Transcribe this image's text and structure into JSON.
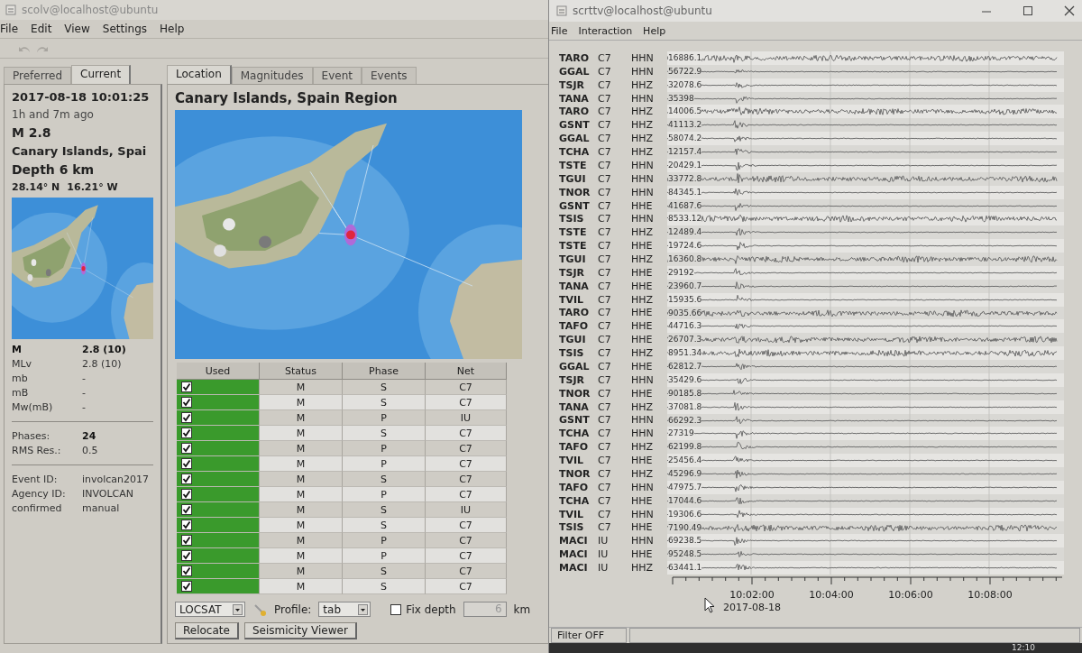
{
  "scolv": {
    "title": "scolv@localhost@ubuntu",
    "menu": [
      "File",
      "Edit",
      "View",
      "Settings",
      "Help"
    ],
    "summary_tabs": [
      {
        "label": "Preferred",
        "selected": false
      },
      {
        "label": "Current",
        "selected": true
      }
    ],
    "origin": {
      "time": "2017-08-18 10:01:25",
      "age": "1h and 7m ago",
      "magnitude": "M 2.8",
      "region": "Canary Islands, Spai",
      "depth": "Depth 6 km",
      "latitude": "28.14° N",
      "longitude": "16.21° W"
    },
    "magnitudes": [
      {
        "type": "M",
        "value": "2.8 (10)",
        "emphasized": true
      },
      {
        "type": "MLv",
        "value": "2.8 (10)",
        "emphasized": false
      },
      {
        "type": "mb",
        "value": "-",
        "emphasized": false
      },
      {
        "type": "mB",
        "value": "-",
        "emphasized": false
      },
      {
        "type": "Mw(mB)",
        "value": "-",
        "emphasized": false
      }
    ],
    "quality": [
      {
        "label": "Phases:",
        "value": "24",
        "emphasized": true
      },
      {
        "label": "RMS Res.:",
        "value": "0.5",
        "emphasized": false
      }
    ],
    "event_info": [
      {
        "label": "Event ID:",
        "value": "involcan2017"
      },
      {
        "label": "Agency ID:",
        "value": "INVOLCAN"
      },
      {
        "label": "confirmed",
        "value": "manual"
      }
    ],
    "tabs": [
      {
        "label": "Location",
        "selected": true
      },
      {
        "label": "Magnitudes",
        "selected": false
      },
      {
        "label": "Event",
        "selected": false
      },
      {
        "label": "Events",
        "selected": false
      }
    ],
    "region_title": "Canary Islands, Spain Region",
    "arrivals": {
      "columns": [
        "Used",
        "Status",
        "Phase",
        "Net"
      ],
      "rows": [
        {
          "used": true,
          "status": "M",
          "phase": "S",
          "net": "C7"
        },
        {
          "used": true,
          "status": "M",
          "phase": "S",
          "net": "C7"
        },
        {
          "used": true,
          "status": "M",
          "phase": "P",
          "net": "IU"
        },
        {
          "used": true,
          "status": "M",
          "phase": "S",
          "net": "C7"
        },
        {
          "used": true,
          "status": "M",
          "phase": "P",
          "net": "C7"
        },
        {
          "used": true,
          "status": "M",
          "phase": "P",
          "net": "C7"
        },
        {
          "used": true,
          "status": "M",
          "phase": "S",
          "net": "C7"
        },
        {
          "used": true,
          "status": "M",
          "phase": "P",
          "net": "C7"
        },
        {
          "used": true,
          "status": "M",
          "phase": "S",
          "net": "IU"
        },
        {
          "used": true,
          "status": "M",
          "phase": "S",
          "net": "C7"
        },
        {
          "used": true,
          "status": "M",
          "phase": "P",
          "net": "C7"
        },
        {
          "used": true,
          "status": "M",
          "phase": "P",
          "net": "C7"
        },
        {
          "used": true,
          "status": "M",
          "phase": "S",
          "net": "C7"
        },
        {
          "used": true,
          "status": "M",
          "phase": "S",
          "net": "C7"
        }
      ]
    },
    "locator": {
      "value": "LOCSAT"
    },
    "profile": {
      "label": "Profile:",
      "value": "tab"
    },
    "fix_depth": {
      "label": "Fix depth",
      "checked": false
    },
    "depth_field": {
      "value": "6",
      "disabled": true,
      "unit": "km"
    },
    "buttons": [
      "Relocate",
      "Seismicity Viewer"
    ]
  },
  "scrttv": {
    "title": "scrttv@localhost@ubuntu",
    "menu": [
      "File",
      "Interaction",
      "Help"
    ],
    "traces": [
      {
        "station": "TARO",
        "network": "C7",
        "channel": "HHN",
        "amplitude": "16886.1",
        "kind": "noisy"
      },
      {
        "station": "GGAL",
        "network": "C7",
        "channel": "HHN",
        "amplitude": "56722.9",
        "kind": "quiet"
      },
      {
        "station": "TSJR",
        "network": "C7",
        "channel": "HHZ",
        "amplitude": "32078.6",
        "kind": "quiet"
      },
      {
        "station": "TANA",
        "network": "C7",
        "channel": "HHN",
        "amplitude": "35398",
        "kind": "quiet"
      },
      {
        "station": "TARO",
        "network": "C7",
        "channel": "HHZ",
        "amplitude": "14006.5",
        "kind": "noisy"
      },
      {
        "station": "GSNT",
        "network": "C7",
        "channel": "HHZ",
        "amplitude": "41113.2",
        "kind": "quiet"
      },
      {
        "station": "GGAL",
        "network": "C7",
        "channel": "HHZ",
        "amplitude": "58074.2",
        "kind": "quiet"
      },
      {
        "station": "TCHA",
        "network": "C7",
        "channel": "HHZ",
        "amplitude": "12157.4",
        "kind": "quiet"
      },
      {
        "station": "TSTE",
        "network": "C7",
        "channel": "HHN",
        "amplitude": "20429.1",
        "kind": "quiet"
      },
      {
        "station": "TGUI",
        "network": "C7",
        "channel": "HHN",
        "amplitude": "33772.8",
        "kind": "noisy"
      },
      {
        "station": "TNOR",
        "network": "C7",
        "channel": "HHN",
        "amplitude": "84345.1",
        "kind": "quiet"
      },
      {
        "station": "GSNT",
        "network": "C7",
        "channel": "HHE",
        "amplitude": "41687.6",
        "kind": "quiet"
      },
      {
        "station": "TSIS",
        "network": "C7",
        "channel": "HHN",
        "amplitude": "8533.12",
        "kind": "noisy"
      },
      {
        "station": "TSTE",
        "network": "C7",
        "channel": "HHZ",
        "amplitude": "12489.4",
        "kind": "quiet"
      },
      {
        "station": "TSTE",
        "network": "C7",
        "channel": "HHE",
        "amplitude": "19724.6",
        "kind": "quiet"
      },
      {
        "station": "TGUI",
        "network": "C7",
        "channel": "HHZ",
        "amplitude": "16360.8",
        "kind": "noisy"
      },
      {
        "station": "TSJR",
        "network": "C7",
        "channel": "HHE",
        "amplitude": "29192",
        "kind": "quiet"
      },
      {
        "station": "TANA",
        "network": "C7",
        "channel": "HHE",
        "amplitude": "23960.7",
        "kind": "quiet"
      },
      {
        "station": "TVIL",
        "network": "C7",
        "channel": "HHZ",
        "amplitude": "15935.6",
        "kind": "quiet"
      },
      {
        "station": "TARO",
        "network": "C7",
        "channel": "HHE",
        "amplitude": "9035.66",
        "kind": "noisy"
      },
      {
        "station": "TAFO",
        "network": "C7",
        "channel": "HHE",
        "amplitude": "44716.3",
        "kind": "quiet"
      },
      {
        "station": "TGUI",
        "network": "C7",
        "channel": "HHE",
        "amplitude": "26707.3",
        "kind": "noisy"
      },
      {
        "station": "TSIS",
        "network": "C7",
        "channel": "HHZ",
        "amplitude": "8951.34",
        "kind": "noisy"
      },
      {
        "station": "GGAL",
        "network": "C7",
        "channel": "HHE",
        "amplitude": "62812.7",
        "kind": "quiet"
      },
      {
        "station": "TSJR",
        "network": "C7",
        "channel": "HHN",
        "amplitude": "35429.6",
        "kind": "quiet"
      },
      {
        "station": "TNOR",
        "network": "C7",
        "channel": "HHE",
        "amplitude": "90185.8",
        "kind": "quiet"
      },
      {
        "station": "TANA",
        "network": "C7",
        "channel": "HHZ",
        "amplitude": "37081.8",
        "kind": "quiet"
      },
      {
        "station": "GSNT",
        "network": "C7",
        "channel": "HHN",
        "amplitude": "66292.3",
        "kind": "quiet"
      },
      {
        "station": "TCHA",
        "network": "C7",
        "channel": "HHN",
        "amplitude": "27319",
        "kind": "quiet"
      },
      {
        "station": "TAFO",
        "network": "C7",
        "channel": "HHZ",
        "amplitude": "62199.8",
        "kind": "quiet"
      },
      {
        "station": "TVIL",
        "network": "C7",
        "channel": "HHE",
        "amplitude": "25456.4",
        "kind": "quiet"
      },
      {
        "station": "TNOR",
        "network": "C7",
        "channel": "HHZ",
        "amplitude": "45296.9",
        "kind": "quiet"
      },
      {
        "station": "TAFO",
        "network": "C7",
        "channel": "HHN",
        "amplitude": "47975.7",
        "kind": "quiet"
      },
      {
        "station": "TCHA",
        "network": "C7",
        "channel": "HHE",
        "amplitude": "17044.6",
        "kind": "quiet"
      },
      {
        "station": "TVIL",
        "network": "C7",
        "channel": "HHN",
        "amplitude": "19306.6",
        "kind": "quiet"
      },
      {
        "station": "TSIS",
        "network": "C7",
        "channel": "HHE",
        "amplitude": "7190.49",
        "kind": "noisy"
      },
      {
        "station": "MACI",
        "network": "IU",
        "channel": "HHN",
        "amplitude": "69238.5",
        "kind": "quiet"
      },
      {
        "station": "MACI",
        "network": "IU",
        "channel": "HHE",
        "amplitude": "95248.5",
        "kind": "quiet"
      },
      {
        "station": "MACI",
        "network": "IU",
        "channel": "HHZ",
        "amplitude": "63441.1",
        "kind": "quiet"
      }
    ],
    "time_labels": [
      "10:02:00",
      "10:04:00",
      "10:06:00",
      "10:08:00"
    ],
    "date": "2017-08-18",
    "status": "Filter OFF"
  },
  "taskbar": {
    "clock": "12:10"
  }
}
